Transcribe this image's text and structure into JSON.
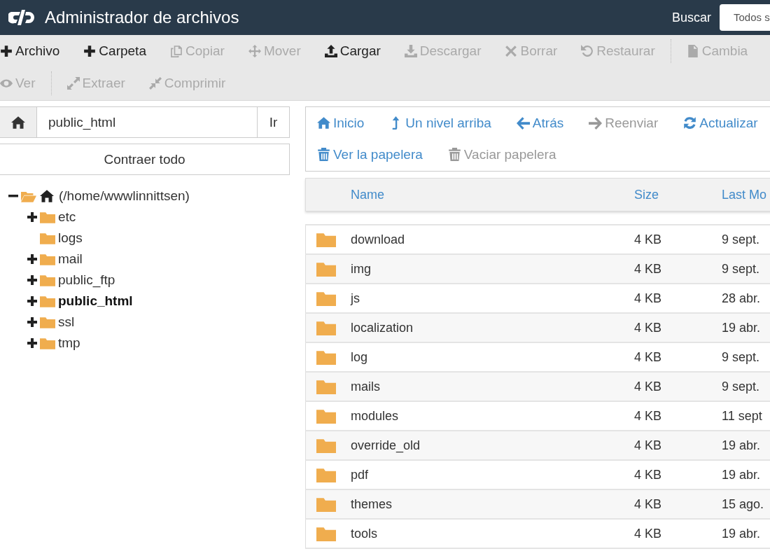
{
  "header": {
    "title": "Administrador de archivos",
    "search_label": "Buscar",
    "search_scope": "Todos s"
  },
  "toolbar": [
    [
      {
        "label": "Archivo",
        "disabled": false
      },
      {
        "label": "Carpeta",
        "disabled": false
      },
      {
        "label": "Copiar",
        "disabled": true
      },
      {
        "label": "Mover",
        "disabled": true
      },
      {
        "label": "Cargar",
        "disabled": false
      },
      {
        "label": "Descargar",
        "disabled": true
      },
      {
        "label": "Borrar",
        "disabled": true
      },
      {
        "label": "Restaurar",
        "disabled": true
      },
      {
        "label": "Cambia",
        "disabled": true
      }
    ],
    [
      {
        "label": "Ver",
        "disabled": true
      },
      {
        "label": "Extraer",
        "disabled": true
      },
      {
        "label": "Comprimir",
        "disabled": true
      }
    ]
  ],
  "path": {
    "value": "public_html",
    "go": "Ir"
  },
  "collapse_all": "Contraer todo",
  "tree": {
    "label": "(/home/wwwlinnittsen)",
    "expanded": true,
    "children": [
      {
        "label": "etc",
        "expandable": true,
        "selected": false
      },
      {
        "label": "logs",
        "expandable": false,
        "selected": false
      },
      {
        "label": "mail",
        "expandable": true,
        "selected": false
      },
      {
        "label": "public_ftp",
        "expandable": true,
        "selected": false
      },
      {
        "label": "public_html",
        "expandable": true,
        "selected": true
      },
      {
        "label": "ssl",
        "expandable": true,
        "selected": false
      },
      {
        "label": "tmp",
        "expandable": true,
        "selected": false
      }
    ]
  },
  "nav": [
    [
      {
        "label": "Inicio",
        "disabled": false
      },
      {
        "label": "Un nivel arriba",
        "disabled": false
      },
      {
        "label": "Atrás",
        "disabled": false
      },
      {
        "label": "Reenviar",
        "disabled": true
      },
      {
        "label": "Actualizar",
        "disabled": false
      }
    ],
    [
      {
        "label": "Ver la papelera",
        "disabled": false
      },
      {
        "label": "Vaciar papelera",
        "disabled": true
      }
    ]
  ],
  "table": {
    "columns": [
      "Name",
      "Size",
      "Last Mo"
    ],
    "rows": [
      {
        "name": "download",
        "size": "4 KB",
        "modified": "9 sept."
      },
      {
        "name": "img",
        "size": "4 KB",
        "modified": "9 sept."
      },
      {
        "name": "js",
        "size": "4 KB",
        "modified": "28 abr."
      },
      {
        "name": "localization",
        "size": "4 KB",
        "modified": "19 abr."
      },
      {
        "name": "log",
        "size": "4 KB",
        "modified": "9 sept."
      },
      {
        "name": "mails",
        "size": "4 KB",
        "modified": "9 sept."
      },
      {
        "name": "modules",
        "size": "4 KB",
        "modified": "11 sept"
      },
      {
        "name": "override_old",
        "size": "4 KB",
        "modified": "19 abr."
      },
      {
        "name": "pdf",
        "size": "4 KB",
        "modified": "19 abr."
      },
      {
        "name": "themes",
        "size": "4 KB",
        "modified": "15 ago."
      },
      {
        "name": "tools",
        "size": "4 KB",
        "modified": "19 abr."
      }
    ]
  }
}
